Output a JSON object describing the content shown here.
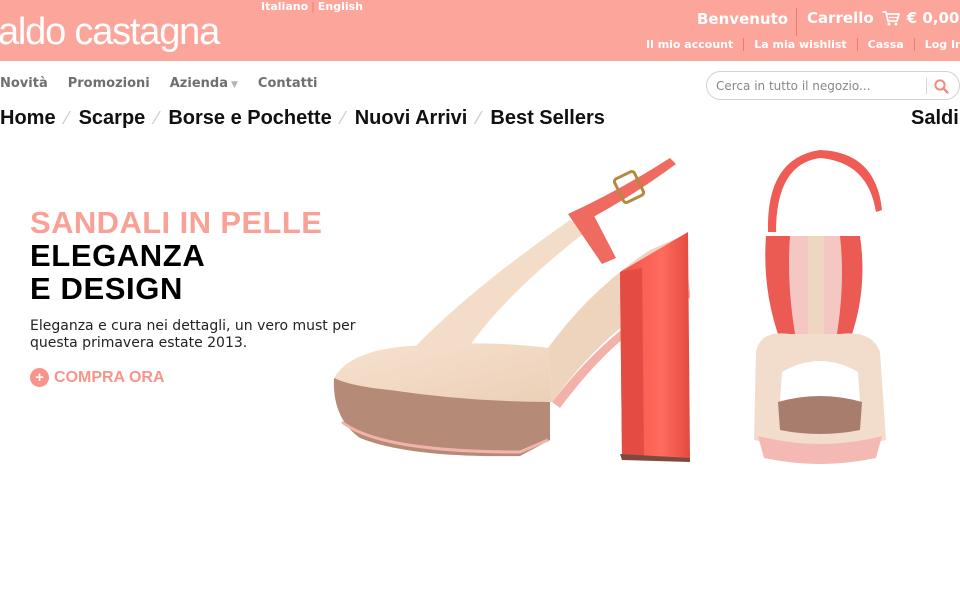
{
  "header": {
    "logo": "aldo castagna",
    "languages": [
      "Italiano",
      "English"
    ],
    "welcome": "Benvenuto",
    "cart_label": "Carrello",
    "cart_total": "€ 0,00",
    "links": [
      "Il mio account",
      "La mia wishlist",
      "Cassa",
      "Log In"
    ],
    "bg_color": "#fca59b"
  },
  "subnav": {
    "items": [
      "Novità",
      "Promozioni",
      "Azienda",
      "Contatti"
    ]
  },
  "search": {
    "placeholder": "Cerca in tutto il negozio..."
  },
  "mainnav": {
    "items": [
      "Home",
      "Scarpe",
      "Borse e Pochette",
      "Nuovi Arrivi",
      "Best Sellers"
    ],
    "right_item": "Saldi"
  },
  "hero": {
    "line1": "SANDALI IN PELLE",
    "line2": "ELEGANZA",
    "line3": "E DESIGN",
    "description": "Eleganza e cura nei dettagli, un vero must per questa primavera estate 2013.",
    "cta": "COMPRA ORA",
    "accent_color": "#f9a196"
  }
}
